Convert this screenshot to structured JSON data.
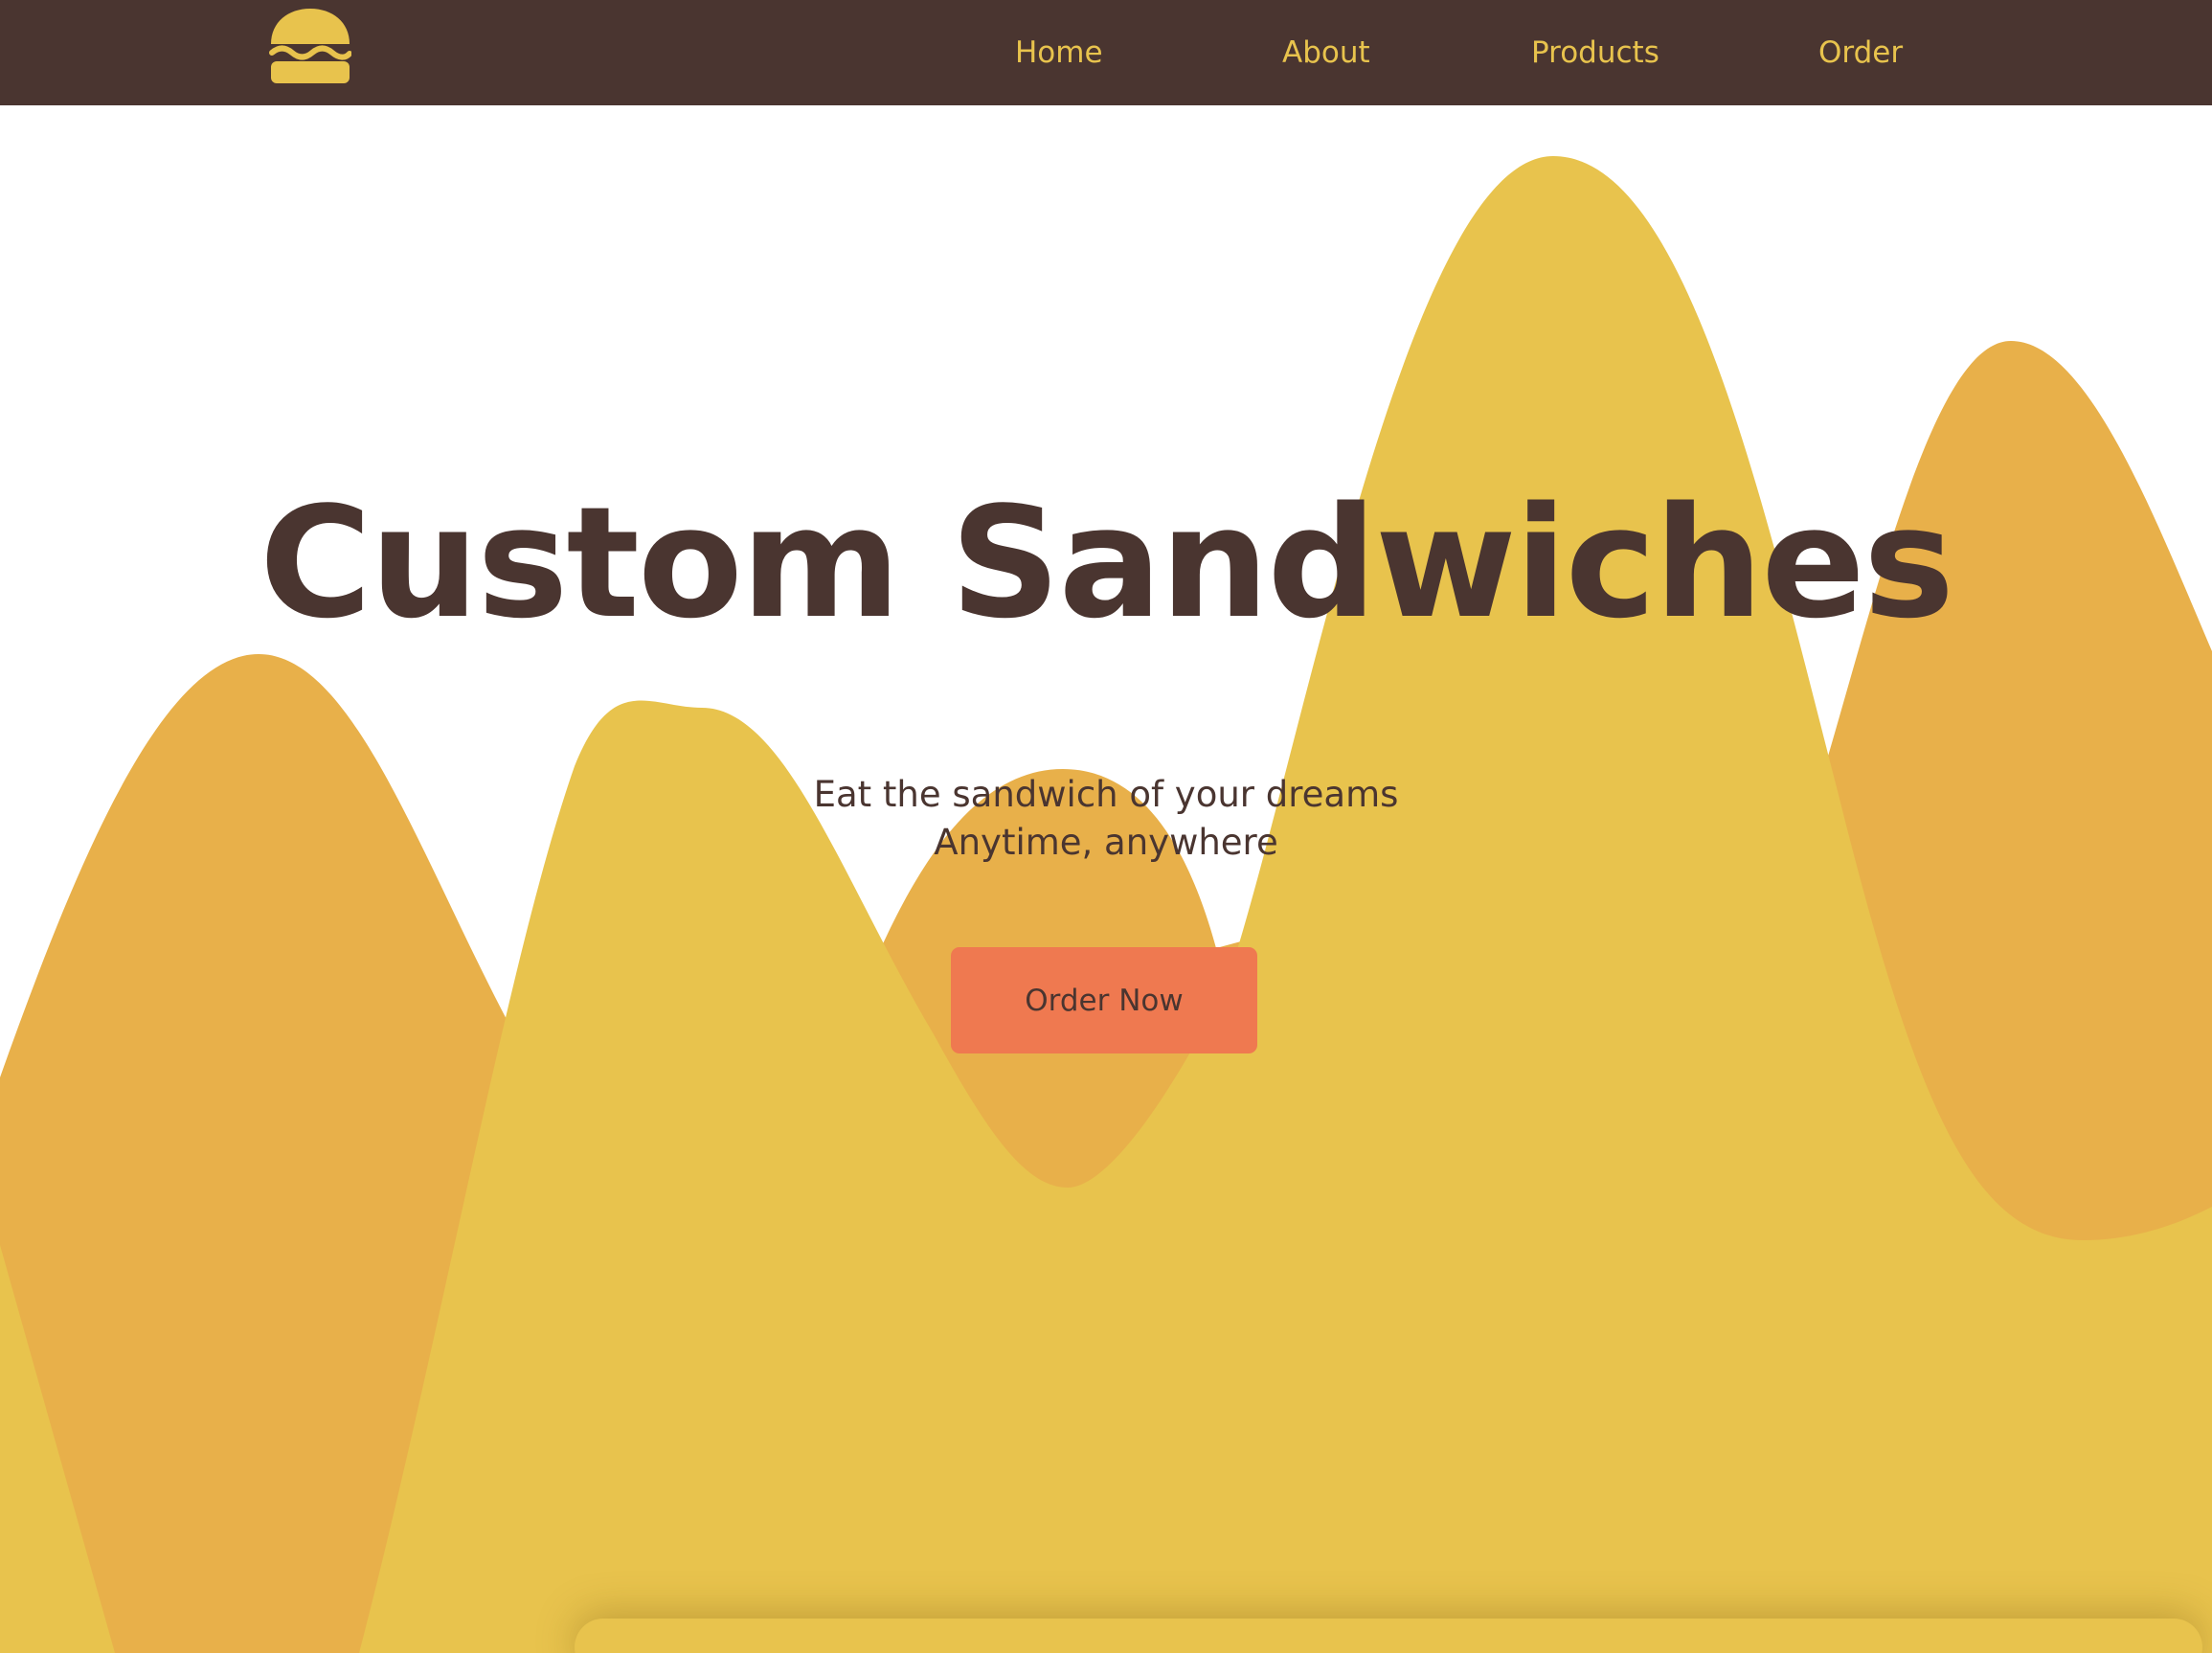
{
  "nav": {
    "logo_icon": "burger-icon",
    "links": [
      {
        "label": "Home"
      },
      {
        "label": "About"
      },
      {
        "label": "Products"
      },
      {
        "label": "Order"
      }
    ]
  },
  "hero": {
    "title": "Custom Sandwiches",
    "tagline_line1": "Eat the sandwich of your dreams",
    "tagline_line2": "Anytime, anywhere",
    "cta_label": "Order Now"
  },
  "colors": {
    "nav_background": "#4a3530",
    "nav_text": "#e8c34d",
    "wave_light": "#e8c34d",
    "wave_dark": "#e8b04a",
    "heading_text": "#4a3530",
    "button_background": "#ef7950"
  }
}
